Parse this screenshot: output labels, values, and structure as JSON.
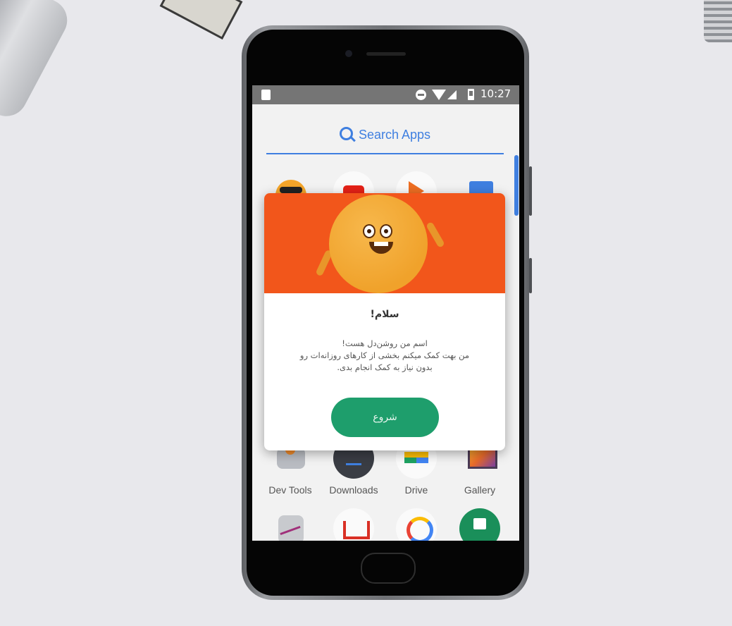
{
  "status_bar": {
    "time": "10:27"
  },
  "search": {
    "placeholder": "Search Apps"
  },
  "apps": [
    {
      "name": "Dev Tools",
      "icon": "dev-tools-icon"
    },
    {
      "name": "Downloads",
      "icon": "downloads-icon"
    },
    {
      "name": "Drive",
      "icon": "drive-icon"
    },
    {
      "name": "Gallery",
      "icon": "gallery-icon"
    }
  ],
  "dialog": {
    "title": "سلام!",
    "body_line_1": "اسم من روشن‌دل هست!",
    "body_line_2": "من بهت کمک میکنم بخشی از کارهای روزانه‌ات رو",
    "body_line_3": "بدون نیاز به کمک انجام بدی.",
    "start_label": "شروع"
  },
  "colors": {
    "accent_blue": "#3f7fe0",
    "banner_orange": "#f2561b",
    "button_green": "#1e9e6c",
    "status_bar_gray": "#757575"
  }
}
